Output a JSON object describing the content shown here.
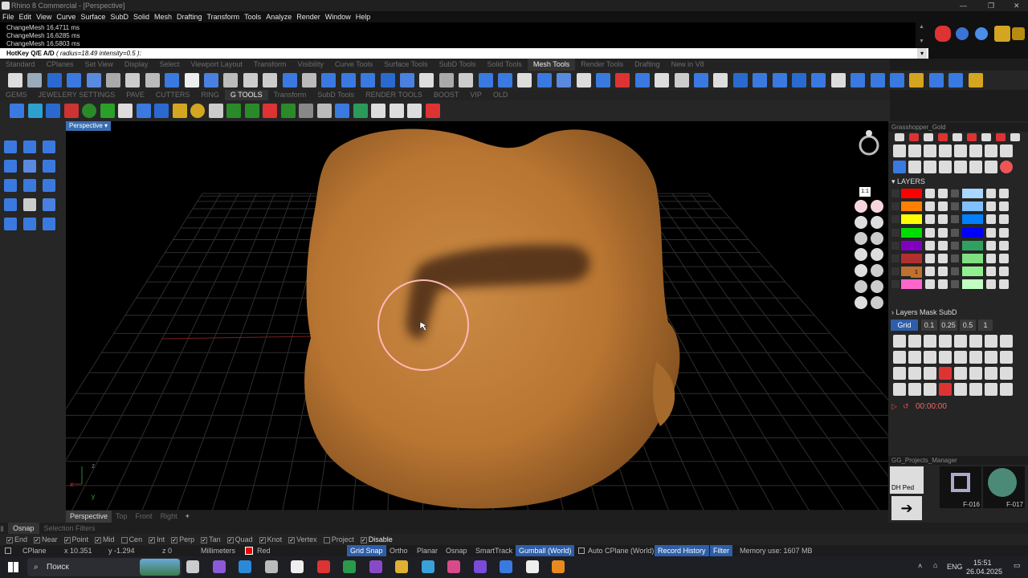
{
  "app": {
    "title": "Rhino 8 Commercial - [Perspective]"
  },
  "menu": [
    "File",
    "Edit",
    "View",
    "Curve",
    "Surface",
    "SubD",
    "Solid",
    "Mesh",
    "Drafting",
    "Transform",
    "Tools",
    "Analyze",
    "Render",
    "Window",
    "Help"
  ],
  "command_history": [
    "ChangeMesh 16,4711 ms",
    "ChangeMesh 16,6285 ms",
    "ChangeMesh 16,5803 ms"
  ],
  "command_line": {
    "label": "HotKey Q/E A/D",
    "params": "( radius=18.49  intensity=0.5 ):"
  },
  "toolbar_tabs_1": [
    "Standard",
    "CPlanes",
    "Set View",
    "Display",
    "Select",
    "Viewport Layout",
    "Transform",
    "Visibility",
    "Curve Tools",
    "Surface Tools",
    "SubD Tools",
    "Solid Tools",
    "Mesh Tools",
    "Render Tools",
    "Drafting",
    "New in V8"
  ],
  "toolbar_tabs_1_active": "Mesh Tools",
  "toolbar_tabs_2": [
    "GEMS",
    "JEWELERY SETTINGS",
    "PAVE",
    "CUTTERS",
    "RING",
    "G TOOLS",
    "Transform",
    "SubD Tools",
    "RENDER TOOLS",
    "BOOST",
    "VIP",
    "OLD"
  ],
  "toolbar_tabs_2_active": "G TOOLS",
  "viewport": {
    "label": "Perspective",
    "axes": {
      "z": "z",
      "x": "x",
      "y": "y"
    }
  },
  "viewport_tabs": [
    "Perspective",
    "Top",
    "Front",
    "Right",
    "+"
  ],
  "right_panel": {
    "gh_title": "Grasshopper_Gold",
    "layers_title": "LAYERS",
    "layer_badge": "1",
    "mask_title": "Layers Mask SubD",
    "grid_buttons": [
      "Grid",
      "0.1",
      "0.25",
      "0.5",
      "1"
    ],
    "timer": "00:00:00",
    "projects_title": "GG_Projects_Manager",
    "project_items": [
      "DH Ped",
      "F-016",
      "F-017"
    ],
    "scale_label": "1:1"
  },
  "colors": {
    "layer_left": [
      "#ff0000",
      "#ff8000",
      "#ffff00",
      "#00dd00",
      "#8000c0",
      "#b03030",
      "#c07030",
      "#ff66cc"
    ],
    "layer_right": [
      "#a8d8ff",
      "#80c0ff",
      "#0080ff",
      "#0000ff",
      "#30a060",
      "#80e080",
      "#90f090",
      "#c0ffc0"
    ],
    "accent": "#2e5ea8"
  },
  "osnap_tabs": [
    "Osnap",
    "Selection Filters"
  ],
  "osnap": [
    {
      "label": "End",
      "checked": true
    },
    {
      "label": "Near",
      "checked": true
    },
    {
      "label": "Point",
      "checked": true
    },
    {
      "label": "Mid",
      "checked": true
    },
    {
      "label": "Cen",
      "checked": false
    },
    {
      "label": "Int",
      "checked": true
    },
    {
      "label": "Perp",
      "checked": true
    },
    {
      "label": "Tan",
      "checked": true
    },
    {
      "label": "Quad",
      "checked": true
    },
    {
      "label": "Knot",
      "checked": true
    },
    {
      "label": "Vertex",
      "checked": true
    },
    {
      "label": "Project",
      "checked": false
    },
    {
      "label": "Disable",
      "checked": true
    }
  ],
  "status": {
    "cplane": "CPlane",
    "x": "x 10.351",
    "y": "y -1.294",
    "z": "z 0",
    "units": "Millimeters",
    "layer": "Red",
    "grid_snap": "Grid Snap",
    "ortho": "Ortho",
    "planar": "Planar",
    "osnap": "Osnap",
    "smarttrack": "SmartTrack",
    "gumball": "Gumball (World)",
    "autocplane": "Auto CPlane (World)",
    "record": "Record History",
    "filter": "Filter",
    "memory": "Memory use: 1607 MB"
  },
  "taskbar": {
    "search": "Поиск",
    "lang": "ENG",
    "time": "15:51",
    "date": "26.04.2025"
  }
}
